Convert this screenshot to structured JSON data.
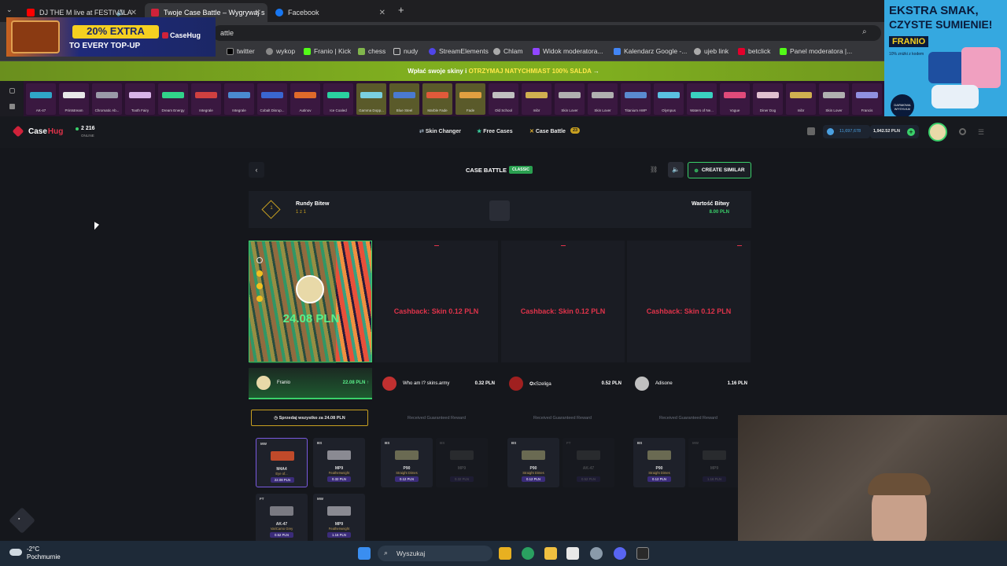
{
  "browser": {
    "tabs": [
      {
        "title": "DJ THE M live at FESTIVALA",
        "favicon_color": "#ff0000"
      },
      {
        "title": "Twoje Case Battle – Wygrywaj s",
        "favicon_color": "#d0223a"
      },
      {
        "title": "Facebook",
        "favicon_color": "#1877f2"
      }
    ],
    "url_fragment": "attle",
    "bookmarks": [
      "twitter",
      "wykop",
      "Franio | Kick",
      "chess",
      "nudy",
      "StreamElements",
      "Chlam",
      "Widok moderatora...",
      "Kalendarz Google -...",
      "ujeb link",
      "betclick",
      "Panel moderatora |..."
    ]
  },
  "overlay_ads": {
    "topup": {
      "text1": "20% EXTRA",
      "text2": "TO EVERY TOP-UP",
      "brand": "CaseHug"
    },
    "snack": {
      "headline1": "EKSTRA SMAK,",
      "headline2": "CZYSTE SUMIENIE!",
      "brand": "FRANIO",
      "sub": "10% zniżki z kodem",
      "badge": "DARMOWA WYSYŁKA!"
    }
  },
  "promo_bar": {
    "prefix": "Wpłać swoje skiny i",
    "highlight": "OTRZYMAJ NATYCHMIAST 100% SALDA",
    "arrow": "→"
  },
  "live_drops": [
    {
      "name": "AK-47",
      "color": "#2fa6c8"
    },
    {
      "name": "Printstream",
      "color": "#e8e8e8"
    },
    {
      "name": "Chromatic Ab...",
      "color": "#9a9aa8"
    },
    {
      "name": "Tooth Fairy",
      "color": "#d8b4e8"
    },
    {
      "name": "Dream Energy",
      "color": "#31d38a"
    },
    {
      "name": "Integrale",
      "color": "#d04040"
    },
    {
      "name": "Integrale",
      "color": "#4a8ad0"
    },
    {
      "name": "Cobalt Disrup...",
      "color": "#3a66d0"
    },
    {
      "name": "Autinov",
      "color": "#e06a2a"
    },
    {
      "name": "Ice Coaled",
      "color": "#2ad0a0"
    },
    {
      "name": "Gamma Dopp...",
      "color": "#7ad0e0"
    },
    {
      "name": "Blue Steel",
      "color": "#4a7ad0"
    },
    {
      "name": "Marble Fade",
      "color": "#e05a3a"
    },
    {
      "name": "Fade",
      "color": "#e0a040"
    },
    {
      "name": "Old School",
      "color": "#c0c0c0"
    },
    {
      "name": "mibr",
      "color": "#d0b050"
    },
    {
      "name": "Skin Lover",
      "color": "#b0b0b0"
    },
    {
      "name": "Skin Lover",
      "color": "#b0b0b0"
    },
    {
      "name": "Titanium AWP",
      "color": "#5a8ad0"
    },
    {
      "name": "Olympus",
      "color": "#5ac0e0"
    },
    {
      "name": "Waters of Ne...",
      "color": "#3ad0c0"
    },
    {
      "name": "Vogue",
      "color": "#e04a7a"
    },
    {
      "name": "Diner Dog",
      "color": "#e0c0d0"
    },
    {
      "name": "mibr",
      "color": "#d0b050"
    },
    {
      "name": "Skin Lover",
      "color": "#b0b0b0"
    },
    {
      "name": "Francis",
      "color": "#9090e0"
    }
  ],
  "site": {
    "logo_a": "Case",
    "logo_b": "Hug",
    "online_count": "2 216",
    "online_label": "ONLINE",
    "nav": [
      "Skin Changer",
      "Free Cases",
      "Case Battle"
    ],
    "case_battle_badge": "23",
    "balance_coins": "11,697,678",
    "balance_pln": "1,942.52 PLN"
  },
  "battle": {
    "title": "CASE BATTLE",
    "mode_badge": "CLASSIC",
    "create_similar": "CREATE SIMILAR",
    "rounds_label": "Rundy Bitew",
    "rounds_value": "1 z 1",
    "round_number": "1",
    "value_label": "Wartość Bitwy",
    "value_amount": "8.00 PLN",
    "winner_amount": "24.08 PLN",
    "cashback_text": "Cashback: Skin 0.12 PLN",
    "players": [
      {
        "name": "Franio",
        "value": "22.08 PLN ↑",
        "avatar_color": "#e8d9a8"
      },
      {
        "name": "Who am I? skins.army",
        "value": "0.32 PLN",
        "avatar_color": "#c03030"
      },
      {
        "name": "✪xSzeliga",
        "value": "0.52 PLN",
        "avatar_color": "#a02020"
      },
      {
        "name": "Adisone",
        "value": "1.16 PLN",
        "avatar_color": "#c0c0c0"
      }
    ],
    "sell_all": "Sprzedaj wszystko za 24.08 PLN",
    "guaranteed_reward": "Received Guaranteed Reward",
    "winner_items": [
      {
        "cond": "MW",
        "name": "M4A4",
        "skin": "Eye of...",
        "price": "22.08 PLN",
        "color": "#c04a2a"
      },
      {
        "cond": "BS",
        "name": "MP9",
        "skin": "Featherweight",
        "price": "0.32 PLN",
        "color": "#8a8a92"
      },
      {
        "cond": "FT",
        "name": "AK-47",
        "skin": "VariCamo Grey",
        "price": "0.52 PLN",
        "color": "#7a7a82"
      },
      {
        "cond": "MW",
        "name": "MP9",
        "skin": "Featherweight",
        "price": "1.16 PLN",
        "color": "#8a8a92"
      }
    ],
    "loser_items": [
      {
        "cond": "BS",
        "name": "P90",
        "skin": "Straight Dimes",
        "price": "0.12 PLN",
        "color": "#6a6a52"
      },
      {
        "cond": "BS",
        "name": "P90",
        "skin": "Straight Dimes",
        "price": "0.12 PLN",
        "color": "#6a6a52"
      },
      {
        "cond": "BS",
        "name": "P90",
        "skin": "Straight Dimes",
        "price": "0.12 PLN",
        "color": "#6a6a52"
      }
    ],
    "faded_items": [
      {
        "cond": "BS",
        "name": "MP9",
        "price": "0.32 PLN"
      },
      {
        "cond": "FT",
        "name": "AK-47",
        "price": "0.52 PLN"
      },
      {
        "cond": "MW",
        "name": "MP9",
        "price": "1.16 PLN"
      }
    ]
  },
  "taskbar": {
    "weather_temp": "-2°C",
    "weather_desc": "Pochmurnie",
    "search_placeholder": "Wyszukaj"
  },
  "colors": {
    "accent_red": "#e0334a",
    "accent_green": "#3ad06a",
    "promo_green": "#7fae1f"
  }
}
